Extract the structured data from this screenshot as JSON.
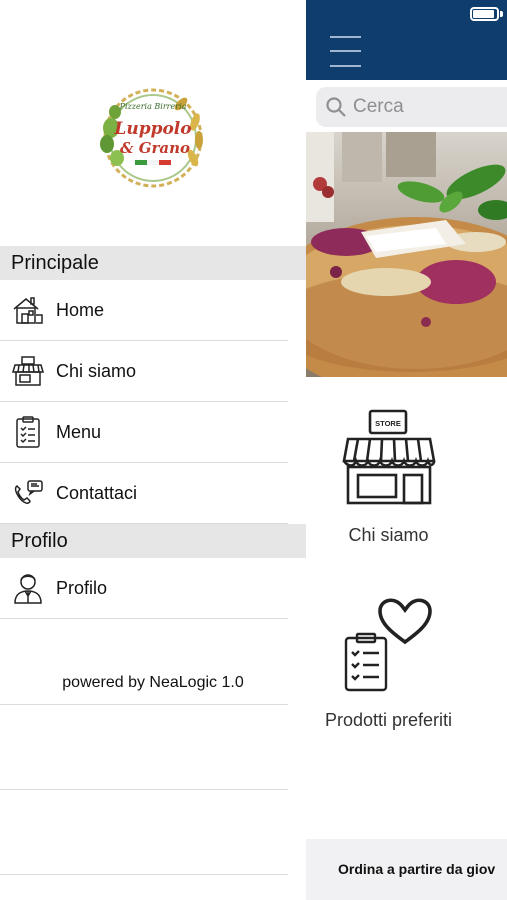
{
  "drawer": {
    "logo": {
      "lines": [
        "Pizzeria Birreria",
        "Luppolo",
        "& Grano"
      ]
    },
    "sections": {
      "principale": "Principale",
      "profilo": "Profilo"
    },
    "items": {
      "home": "Home",
      "chi_siamo": "Chi siamo",
      "menu": "Menu",
      "contattaci": "Contattaci",
      "profilo": "Profilo"
    },
    "footer": "powered by NeaLogic 1.0"
  },
  "main": {
    "search": {
      "placeholder": "Cerca"
    },
    "tiles": {
      "chi_siamo": "Chi siamo",
      "store_sign": "STORE",
      "preferiti": "Prodotti preferiti"
    },
    "bottom_bar": {
      "text": "Ordina a partire da giov"
    }
  },
  "colors": {
    "topbar": "#0f3e6e",
    "section_header_bg": "#e6e6e6",
    "search_bg": "#ececee"
  },
  "icons": [
    "house-icon",
    "store-icon",
    "clipboard-list-icon",
    "phone-chat-icon",
    "user-icon",
    "search-icon",
    "hamburger-icon",
    "heart-icon",
    "battery-icon"
  ]
}
